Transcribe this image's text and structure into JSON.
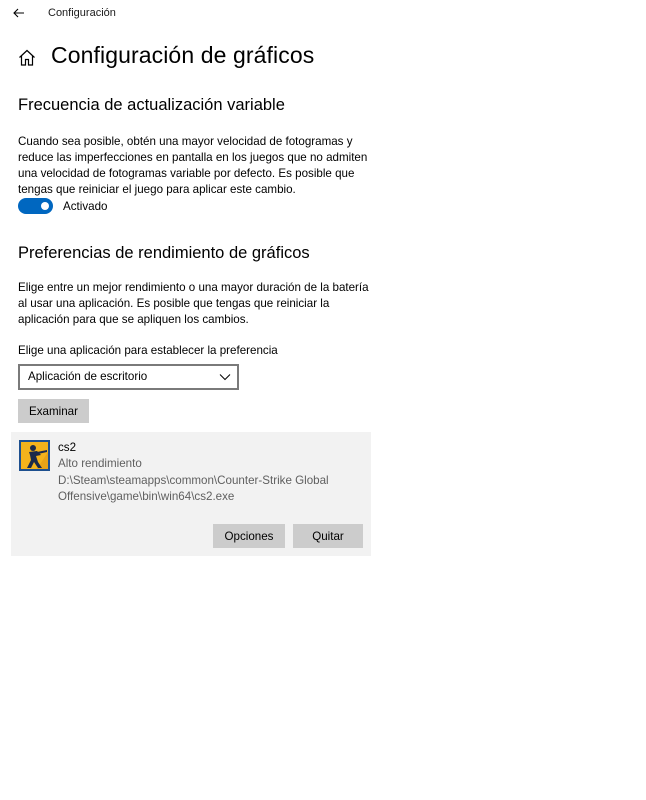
{
  "window": {
    "title": "Configuración",
    "back_icon": "back-arrow-icon"
  },
  "header": {
    "home_icon": "home-icon",
    "title": "Configuración de gráficos"
  },
  "variable_refresh": {
    "heading": "Frecuencia de actualización variable",
    "description": "Cuando sea posible, obtén una mayor velocidad de fotogramas y reduce las imperfecciones en pantalla en los juegos que no admiten una velocidad de fotogramas variable por defecto. Es posible que tengas que reiniciar el juego para aplicar este cambio.",
    "toggle_state": "on",
    "toggle_label": "Activado",
    "accent_color": "#0067c0"
  },
  "performance": {
    "heading": "Preferencias de rendimiento de gráficos",
    "description": "Elige entre un mejor rendimiento o una mayor duración de la batería al usar una aplicación. Es posible que tengas que reiniciar la aplicación para que se apliquen los cambios.",
    "choose_label": "Elige una aplicación para establecer la preferencia",
    "dropdown_value": "Aplicación de escritorio",
    "browse_button": "Examinar"
  },
  "app": {
    "name": "cs2",
    "preference": "Alto rendimiento",
    "path": "D:\\Steam\\steamapps\\common\\Counter-Strike Global Offensive\\game\\bin\\win64\\cs2.exe",
    "icon": "counter-strike-app-icon",
    "options_button": "Opciones",
    "remove_button": "Quitar"
  }
}
